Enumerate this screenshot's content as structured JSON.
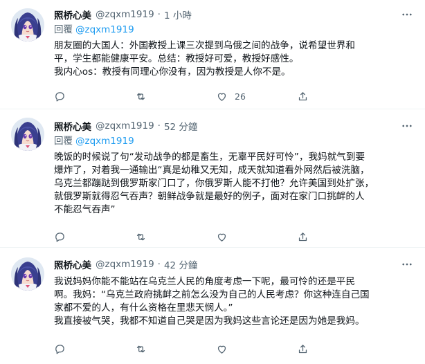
{
  "colors": {
    "accent": "#1d9bf0",
    "secondary_text": "#536471",
    "divider": "#eff3f4"
  },
  "tweets": [
    {
      "name": "照桥心美",
      "handle": "@zqxm1919",
      "separator": "·",
      "time": "1 小時",
      "reply_label": "回覆",
      "reply_mention": "@zqxm1919",
      "lines": [
        "朋友圈的大国人：外国教授上课三次提到乌俄之间的战争，说希望世界和",
        "平，学生都能健康平安。总结：教授好可爱，教授好感性。",
        "我内心os：教授有同理心你没有，因为教授是人你不是。"
      ],
      "like_count": "26",
      "icons": [
        "reply-icon",
        "retweet-icon",
        "like-icon",
        "share-icon",
        "more-icon"
      ]
    },
    {
      "name": "照桥心美",
      "handle": "@zqxm1919",
      "separator": "·",
      "time": "52 分鐘",
      "reply_label": "回覆",
      "reply_mention": "@zqxm1919",
      "lines": [
        "晚饭的时候说了句“发动战争的都是畜生，无辜平民好可怜”，我妈就气到要",
        "爆炸了，对着我一通输出“真是幼稚又无知，成天就知道看外网然后被洗脑，",
        "乌克兰都蹦跶到俄罗斯家门口了，你俄罗斯人能不打他？允许美国到处扩张，",
        "就俄罗斯就得忍气吞声？朝鲜战争就是最好的例子，面对在家门口挑衅的人",
        "不能忍气吞声”"
      ],
      "like_count": "",
      "icons": [
        "reply-icon",
        "retweet-icon",
        "like-icon",
        "share-icon",
        "more-icon"
      ]
    },
    {
      "name": "照桥心美",
      "handle": "@zqxm1919",
      "separator": "·",
      "time": "42 分鐘",
      "lines": [
        "我说妈妈你能不能站在乌克兰人民的角度考虑一下呢，最可怜的还是平民",
        "啊。我妈：“乌克兰政府挑衅之前怎么没为自己的人民考虑？你这种连自己国",
        "家都不爱的人，有什么资格在里悲天悯人。”",
        "我直接被气哭，我都不知道自己哭是因为我妈这些言论还是因为她是我妈。"
      ],
      "like_count": "",
      "icons": [
        "reply-icon",
        "retweet-icon",
        "like-icon",
        "share-icon",
        "more-icon"
      ]
    }
  ]
}
